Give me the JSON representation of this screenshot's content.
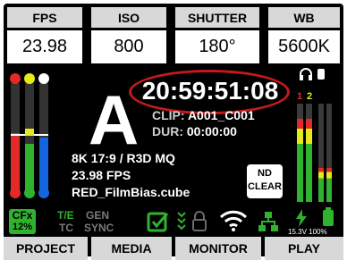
{
  "header": {
    "labels": [
      "FPS",
      "ISO",
      "SHUTTER",
      "WB"
    ],
    "values": [
      "23.98",
      "800",
      "180°",
      "5600K"
    ]
  },
  "reel": "A",
  "timecode": "20:59:51:08",
  "clip": {
    "label": "CLIP:",
    "value": "A001_C001"
  },
  "duration": {
    "label": "DUR:",
    "value": "00:00:00"
  },
  "format": {
    "resolution": "8K 17:9 / R3D MQ",
    "fps": "23.98 FPS",
    "lut": "RED_FilmBias.cube"
  },
  "nd": {
    "line1": "ND",
    "line2": "CLEAR"
  },
  "status": {
    "cfx_top": "CFx",
    "cfx_bottom": "12%",
    "te": "T/E",
    "tc": "TC",
    "gen": "GEN",
    "sync": "SYNC",
    "voltage": "15.3V 100%"
  },
  "audio": {
    "ch1": "1",
    "ch2": "2"
  },
  "meters": {
    "left_levels": [
      0.55,
      0.45,
      0.45
    ],
    "audio_levels": [
      0.85,
      0.85,
      0.35,
      0.35
    ]
  },
  "colors": {
    "accent_green": "#2fb32f",
    "red": "#e22a2a",
    "yellow": "#e6e91a",
    "blue": "#1565e0",
    "ring": "#c41a1a"
  },
  "nav": {
    "tabs": [
      "PROJECT",
      "MEDIA",
      "MONITOR",
      "PLAY"
    ]
  }
}
